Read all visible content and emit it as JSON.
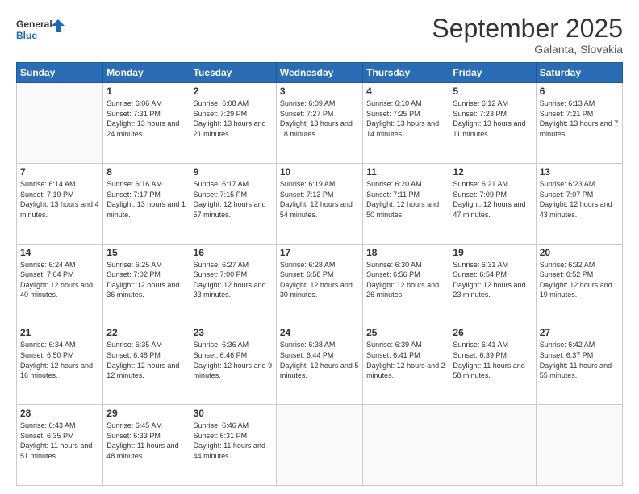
{
  "header": {
    "logo_line1": "General",
    "logo_line2": "Blue",
    "month_title": "September 2025",
    "location": "Galanta, Slovakia"
  },
  "weekdays": [
    "Sunday",
    "Monday",
    "Tuesday",
    "Wednesday",
    "Thursday",
    "Friday",
    "Saturday"
  ],
  "weeks": [
    [
      {
        "day": "",
        "sunrise": "",
        "sunset": "",
        "daylight": ""
      },
      {
        "day": "1",
        "sunrise": "6:06 AM",
        "sunset": "7:31 PM",
        "daylight": "13 hours and 24 minutes."
      },
      {
        "day": "2",
        "sunrise": "6:08 AM",
        "sunset": "7:29 PM",
        "daylight": "13 hours and 21 minutes."
      },
      {
        "day": "3",
        "sunrise": "6:09 AM",
        "sunset": "7:27 PM",
        "daylight": "13 hours and 18 minutes."
      },
      {
        "day": "4",
        "sunrise": "6:10 AM",
        "sunset": "7:25 PM",
        "daylight": "13 hours and 14 minutes."
      },
      {
        "day": "5",
        "sunrise": "6:12 AM",
        "sunset": "7:23 PM",
        "daylight": "13 hours and 11 minutes."
      },
      {
        "day": "6",
        "sunrise": "6:13 AM",
        "sunset": "7:21 PM",
        "daylight": "13 hours and 7 minutes."
      }
    ],
    [
      {
        "day": "7",
        "sunrise": "6:14 AM",
        "sunset": "7:19 PM",
        "daylight": "13 hours and 4 minutes."
      },
      {
        "day": "8",
        "sunrise": "6:16 AM",
        "sunset": "7:17 PM",
        "daylight": "13 hours and 1 minute."
      },
      {
        "day": "9",
        "sunrise": "6:17 AM",
        "sunset": "7:15 PM",
        "daylight": "12 hours and 57 minutes."
      },
      {
        "day": "10",
        "sunrise": "6:19 AM",
        "sunset": "7:13 PM",
        "daylight": "12 hours and 54 minutes."
      },
      {
        "day": "11",
        "sunrise": "6:20 AM",
        "sunset": "7:11 PM",
        "daylight": "12 hours and 50 minutes."
      },
      {
        "day": "12",
        "sunrise": "6:21 AM",
        "sunset": "7:09 PM",
        "daylight": "12 hours and 47 minutes."
      },
      {
        "day": "13",
        "sunrise": "6:23 AM",
        "sunset": "7:07 PM",
        "daylight": "12 hours and 43 minutes."
      }
    ],
    [
      {
        "day": "14",
        "sunrise": "6:24 AM",
        "sunset": "7:04 PM",
        "daylight": "12 hours and 40 minutes."
      },
      {
        "day": "15",
        "sunrise": "6:25 AM",
        "sunset": "7:02 PM",
        "daylight": "12 hours and 36 minutes."
      },
      {
        "day": "16",
        "sunrise": "6:27 AM",
        "sunset": "7:00 PM",
        "daylight": "12 hours and 33 minutes."
      },
      {
        "day": "17",
        "sunrise": "6:28 AM",
        "sunset": "6:58 PM",
        "daylight": "12 hours and 30 minutes."
      },
      {
        "day": "18",
        "sunrise": "6:30 AM",
        "sunset": "6:56 PM",
        "daylight": "12 hours and 26 minutes."
      },
      {
        "day": "19",
        "sunrise": "6:31 AM",
        "sunset": "6:54 PM",
        "daylight": "12 hours and 23 minutes."
      },
      {
        "day": "20",
        "sunrise": "6:32 AM",
        "sunset": "6:52 PM",
        "daylight": "12 hours and 19 minutes."
      }
    ],
    [
      {
        "day": "21",
        "sunrise": "6:34 AM",
        "sunset": "6:50 PM",
        "daylight": "12 hours and 16 minutes."
      },
      {
        "day": "22",
        "sunrise": "6:35 AM",
        "sunset": "6:48 PM",
        "daylight": "12 hours and 12 minutes."
      },
      {
        "day": "23",
        "sunrise": "6:36 AM",
        "sunset": "6:46 PM",
        "daylight": "12 hours and 9 minutes."
      },
      {
        "day": "24",
        "sunrise": "6:38 AM",
        "sunset": "6:44 PM",
        "daylight": "12 hours and 5 minutes."
      },
      {
        "day": "25",
        "sunrise": "6:39 AM",
        "sunset": "6:41 PM",
        "daylight": "12 hours and 2 minutes."
      },
      {
        "day": "26",
        "sunrise": "6:41 AM",
        "sunset": "6:39 PM",
        "daylight": "11 hours and 58 minutes."
      },
      {
        "day": "27",
        "sunrise": "6:42 AM",
        "sunset": "6:37 PM",
        "daylight": "11 hours and 55 minutes."
      }
    ],
    [
      {
        "day": "28",
        "sunrise": "6:43 AM",
        "sunset": "6:35 PM",
        "daylight": "11 hours and 51 minutes."
      },
      {
        "day": "29",
        "sunrise": "6:45 AM",
        "sunset": "6:33 PM",
        "daylight": "11 hours and 48 minutes."
      },
      {
        "day": "30",
        "sunrise": "6:46 AM",
        "sunset": "6:31 PM",
        "daylight": "11 hours and 44 minutes."
      },
      {
        "day": "",
        "sunrise": "",
        "sunset": "",
        "daylight": ""
      },
      {
        "day": "",
        "sunrise": "",
        "sunset": "",
        "daylight": ""
      },
      {
        "day": "",
        "sunrise": "",
        "sunset": "",
        "daylight": ""
      },
      {
        "day": "",
        "sunrise": "",
        "sunset": "",
        "daylight": ""
      }
    ]
  ]
}
